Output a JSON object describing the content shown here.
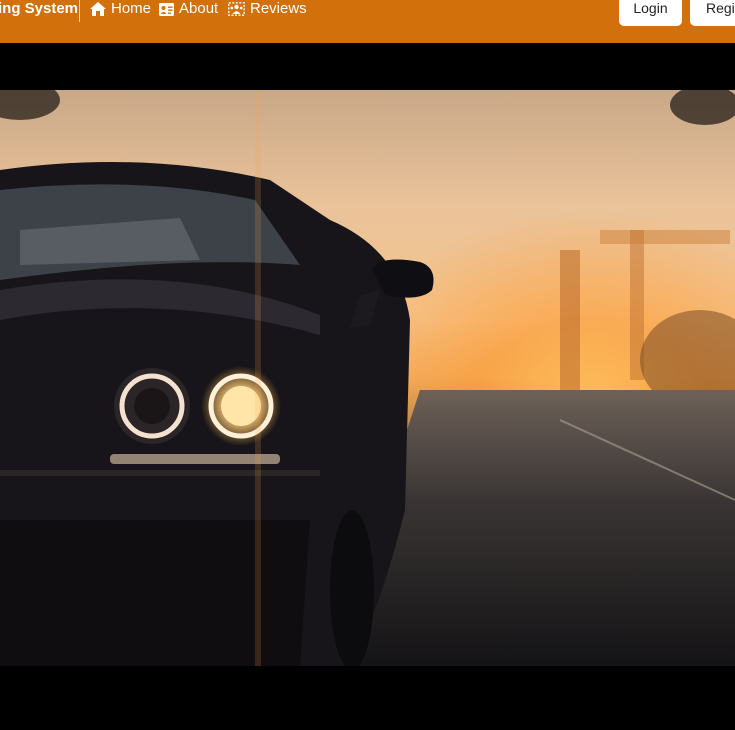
{
  "brand": {
    "title": "ing System"
  },
  "nav": {
    "items": [
      {
        "label": "Home",
        "icon": "home-icon"
      },
      {
        "label": "About",
        "icon": "id-card-icon"
      },
      {
        "label": "Reviews",
        "icon": "users-icon"
      }
    ]
  },
  "auth": {
    "login_label": "Login",
    "register_label": "Regis"
  },
  "colors": {
    "navbar": "#d2700b",
    "background": "#000000",
    "button_bg": "#ffffff"
  },
  "hero": {
    "image": "black-muscle-car-headlights-sunset-road"
  }
}
